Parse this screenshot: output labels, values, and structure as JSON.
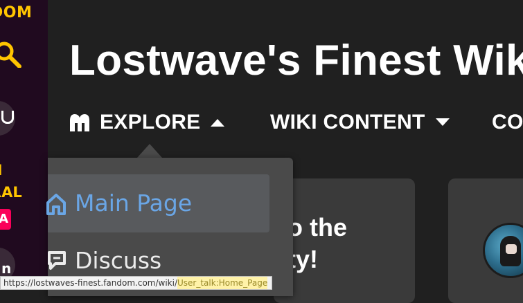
{
  "rail": {
    "logo_text": "DOM",
    "fan_text_line1": "N",
    "fan_text_line2": "RAL",
    "badge_text": "A",
    "circle_glyph": "n",
    "icons": [
      "search-icon",
      "user-icon"
    ]
  },
  "header": {
    "wiki_title": "Lostwave's Finest Wiki"
  },
  "nav": {
    "explore_label": "EXPLORE",
    "wiki_content_label": "WIKI CONTENT",
    "community_label": "CO"
  },
  "dropdown": {
    "items": [
      {
        "label": "Main Page",
        "icon": "home-icon",
        "active": true
      },
      {
        "label": "Discuss",
        "icon": "discuss-icon",
        "active": false
      }
    ]
  },
  "cards": {
    "card1_line1": "o the",
    "card1_line2": "ty!"
  },
  "statusbar": {
    "url_prefix": "https://lostwaves-finest.fandom.com/wiki/",
    "url_highlight": "User_talk:Home_Page"
  },
  "colors": {
    "fandom_yellow": "#ffc500",
    "fandom_pink": "#fa005a",
    "link_blue": "#6aa6e6",
    "background": "#202020"
  }
}
